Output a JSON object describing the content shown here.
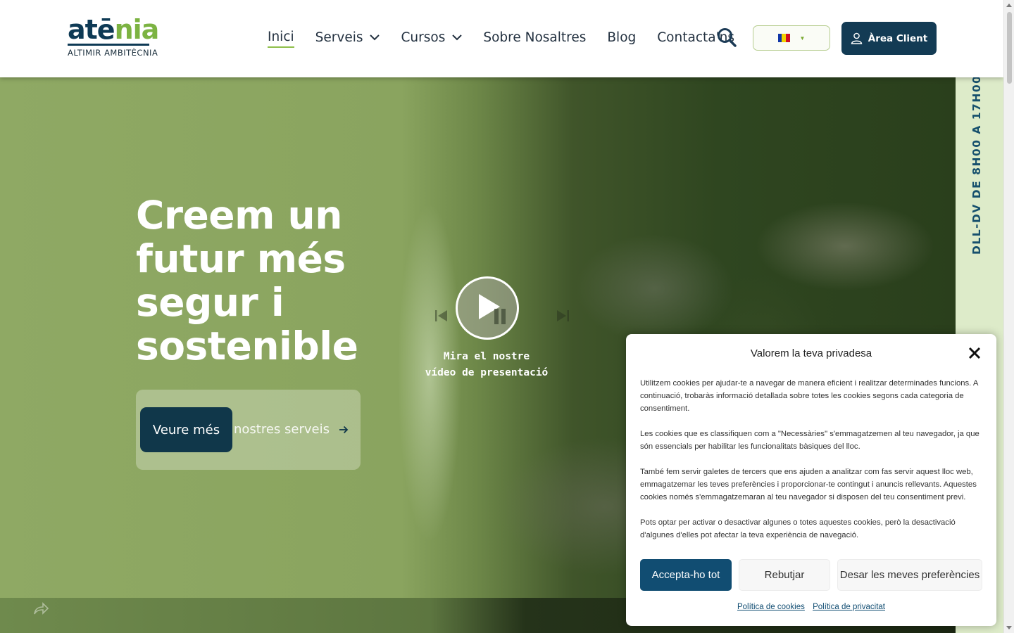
{
  "header": {
    "logo": {
      "word_part1": "atē",
      "word_part2": "nia",
      "tagline": "ALTIMIR AMBITÈCNIA"
    },
    "nav": [
      {
        "label": "Inici",
        "active": true,
        "dropdown": false
      },
      {
        "label": "Serveis",
        "active": false,
        "dropdown": true
      },
      {
        "label": "Cursos",
        "active": false,
        "dropdown": true
      },
      {
        "label": "Sobre Nosaltres",
        "active": false,
        "dropdown": false
      },
      {
        "label": "Blog",
        "active": false,
        "dropdown": false
      },
      {
        "label": "Contacta'ns",
        "active": false,
        "dropdown": false
      }
    ],
    "search_icon": "search-icon",
    "language": {
      "flag": "andorra-flag",
      "flag_colors": [
        "#1036a8",
        "#f2d300",
        "#d20f23"
      ]
    },
    "client_button": "Àrea Client"
  },
  "hero": {
    "title": "Creem un futur més segur i sostenible",
    "cta_button": "Veure més",
    "cta_text": "nostres serveis",
    "video_caption_line1": "Mira el nostre",
    "video_caption_line2": "vídeo de presentació",
    "side_text": "DLL-DV    DE 8H00 A 17H00"
  },
  "cookie_dialog": {
    "title": "Valorem la teva privadesa",
    "paragraphs": [
      "Utilitzem cookies per ajudar-te a navegar de manera eficient i realitzar determinades funcions. A continuació, trobaràs informació detallada sobre totes les cookies segons cada categoria de consentiment.",
      "Les cookies que es classifiquen com a \"Necessàries\" s'emmagatzemen al teu navegador, ja que són essencials per habilitar les funcionalitats bàsiques del lloc.",
      "També fem servir galetes de tercers que ens ajuden a analitzar com fas servir aquest lloc web, emmagatzemar les teves preferències i proporcionar-te contingut i anuncis rellevants. Aquestes cookies només s'emmagatzemaran al teu navegador si disposen del teu consentiment previ.",
      "Pots optar per activar o desactivar algunes o totes aquestes cookies, però la desactivació d'algunes d'elles pot afectar la teva experiència de navegació."
    ],
    "buttons": {
      "accept": "Accepta-ho tot",
      "reject": "Rebutjar",
      "save": "Desar les meves preferències"
    },
    "links": {
      "cookies": "Política de cookies",
      "privacy": "Política de privacitat"
    }
  },
  "colors": {
    "brand_dark": "#133b54",
    "brand_green": "#7cb342",
    "accept_blue": "#114d72",
    "side_strip": "#ddebc9"
  }
}
